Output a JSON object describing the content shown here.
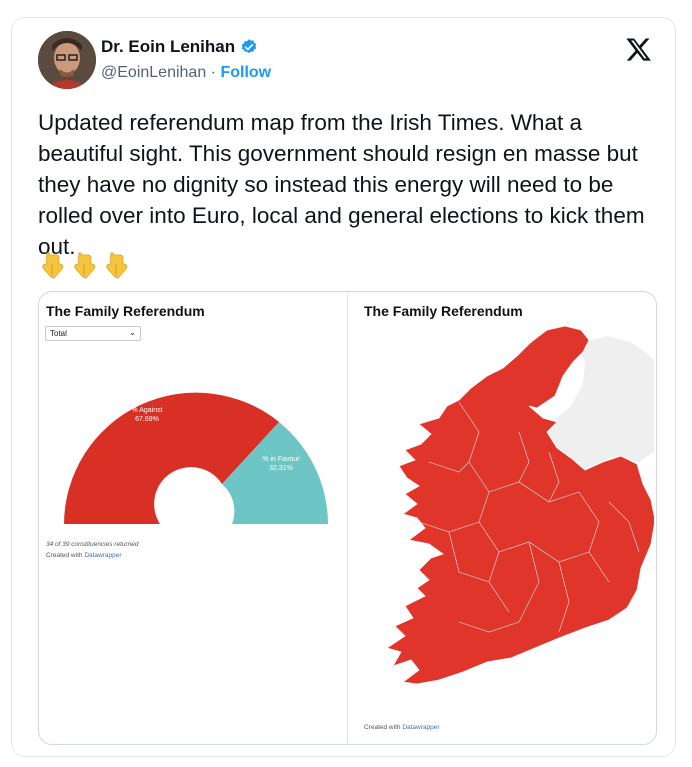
{
  "author": {
    "name": "Dr. Eoin Lenihan",
    "handle": "@EoinLenihan",
    "separator": "·",
    "follow_label": "Follow"
  },
  "tweet": {
    "text": "Updated referendum map from the Irish Times. What a beautiful sight. This government should resign en masse but they have no dignity so instead this energy will need to be rolled over into Euro, local and general elections to kick them out.",
    "emojis": [
      "pointing-down-emoji",
      "pointing-down-emoji",
      "pointing-down-emoji"
    ]
  },
  "media": {
    "left_panel": {
      "title": "The Family Referendum",
      "dropdown_value": "Total",
      "slices": [
        {
          "label": "% Against",
          "value": "67.69%",
          "color": "#d93025"
        },
        {
          "label": "% in Favour",
          "value": "32.31%",
          "color": "#6dc5c5"
        }
      ],
      "footnote": "34 of 39 constituencies returned",
      "created_with": "Created with",
      "created_with_link": "Datawrapper"
    },
    "right_panel": {
      "title": "The Family Referendum",
      "created_with": "Created with",
      "created_with_link": "Datawrapper",
      "map_color": "#e0352b",
      "northern_ireland_color": "#efefef"
    }
  },
  "colors": {
    "verified": "#1d9bf0",
    "follow": "#1d9bf0",
    "text": "#0f1419",
    "secondary": "#536471"
  }
}
